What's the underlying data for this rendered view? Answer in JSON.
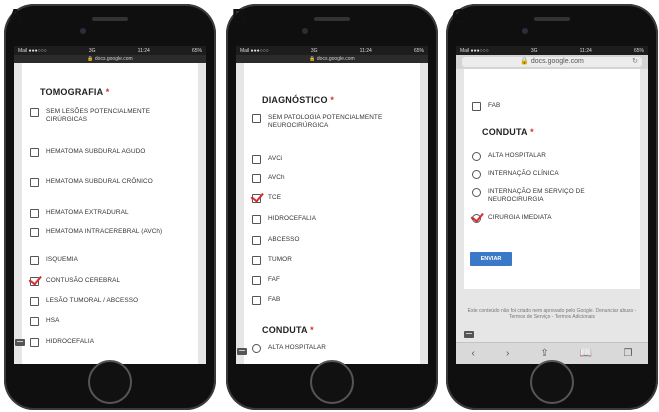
{
  "panels": [
    {
      "letter": "A",
      "status": {
        "carrier": "Mail ●●●○○○",
        "network": "3G",
        "time": "11:24",
        "battery": "65%"
      },
      "url": "docs.google.com",
      "section": {
        "title": "TOMOGRAFIA",
        "required": "*"
      },
      "options": [
        {
          "label": "SEM LESÕES POTENCIALMENTE CIRÚRGICAS",
          "checked": false
        },
        {
          "label": "HEMATOMA SUBDURAL AGUDO",
          "checked": false
        },
        {
          "label": "HEMATOMA SUBDURAL CRÔNICO",
          "checked": false
        },
        {
          "label": "HEMATOMA EXTRADURAL",
          "checked": false
        },
        {
          "label": "HEMATOMA INTRACEREBRAL (AVCh)",
          "checked": false
        },
        {
          "label": "ISQUEMIA",
          "checked": false
        },
        {
          "label": "CONTUSÃO CEREBRAL",
          "checked": true
        },
        {
          "label": "LESÃO TUMORAL / ABCESSO",
          "checked": false
        },
        {
          "label": "HSA",
          "checked": false
        },
        {
          "label": "HIDROCEFALIA",
          "checked": false
        }
      ]
    },
    {
      "letter": "B",
      "status": {
        "carrier": "Mail ●●●○○○",
        "network": "3G",
        "time": "11:24",
        "battery": "65%"
      },
      "url": "docs.google.com",
      "section": {
        "title": "DIAGNÓSTICO",
        "required": "*"
      },
      "options": [
        {
          "label": "SEM PATOLOGIA POTENCIALMENTE NEUROCIRÚRGICA",
          "checked": false
        },
        {
          "label": "AVCi",
          "checked": false
        },
        {
          "label": "AVCh",
          "checked": false
        },
        {
          "label": "TCE",
          "checked": true
        },
        {
          "label": "HIDROCEFALIA",
          "checked": false
        },
        {
          "label": "ABCESSO",
          "checked": false
        },
        {
          "label": "TUMOR",
          "checked": false
        },
        {
          "label": "FAF",
          "checked": false
        },
        {
          "label": "FAB",
          "checked": false
        }
      ],
      "section2": {
        "title": "CONDUTA",
        "required": "*"
      },
      "radios": [
        {
          "label": "ALTA HOSPITALAR",
          "checked": false
        }
      ]
    },
    {
      "letter": "C",
      "status": {
        "carrier": "Mail ●●●○○○",
        "network": "3G",
        "time": "11:24",
        "battery": "65%"
      },
      "url": "docs.google.com",
      "top_option": {
        "label": "FAB",
        "checked": false
      },
      "section": {
        "title": "CONDUTA",
        "required": "*"
      },
      "radios": [
        {
          "label": "ALTA HOSPITALAR",
          "checked": false
        },
        {
          "label": "INTERNAÇÃO CLÍNICA",
          "checked": false
        },
        {
          "label": "INTERNAÇÃO EM SERVIÇO DE NEUROCIRURGIA",
          "checked": false
        },
        {
          "label": "CIRURGIA IMEDIATA",
          "checked": true
        }
      ],
      "submit": "ENVIAR",
      "footer": "Este conteúdo não foi criado nem aprovado pelo Google. Denunciar abuso - Termos de Serviço - Termos Adicionais",
      "toolbar": [
        "back-icon",
        "forward-icon",
        "share-icon",
        "bookmarks-icon",
        "tabs-icon"
      ]
    }
  ],
  "colors": {
    "required": "#d32f2f",
    "check": "#d32f2f",
    "button": "#3b78c7"
  }
}
